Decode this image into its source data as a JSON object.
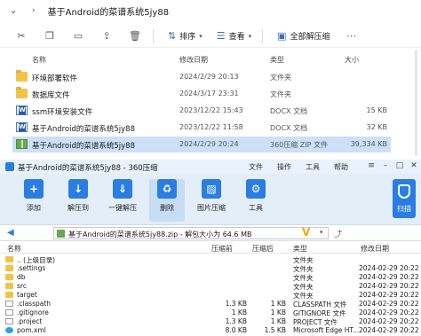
{
  "explorer": {
    "breadcrumb": "基于Android的菜谱系统5jy88",
    "toolbar": {
      "sort_label": "排序",
      "view_label": "查看",
      "extract_all_label": "全部解压缩"
    },
    "columns": {
      "name": "名称",
      "date": "修改日期",
      "type": "类型",
      "size": "大小"
    },
    "files": [
      {
        "name": "环境部署软件",
        "date": "2024/2/29 20:13",
        "type": "文件夹",
        "size": "",
        "icon": "folder-icon",
        "selected": false
      },
      {
        "name": "数据库文件",
        "date": "2024/3/17 23:31",
        "type": "文件夹",
        "size": "",
        "icon": "folder-icon",
        "selected": false
      },
      {
        "name": "ssm环境安装文件",
        "date": "2023/12/22 15:43",
        "type": "DOCX 文档",
        "size": "15 KB",
        "icon": "docx-icon",
        "selected": false
      },
      {
        "name": "基于Android的菜谱系统5jy88",
        "date": "2023/12/22 11:58",
        "type": "DOCX 文档",
        "size": "32 KB",
        "icon": "docx-icon",
        "selected": false
      },
      {
        "name": "基于Android的菜谱系统5jy88",
        "date": "2024/2/29 20:24",
        "type": "360压缩 ZIP 文件",
        "size": "39,334 KB",
        "icon": "zip-icon",
        "selected": true
      }
    ]
  },
  "zipwin": {
    "title": "基于Android的菜谱系统5jy88 - 360压缩",
    "menu": [
      "文件",
      "操作",
      "工具",
      "帮助"
    ],
    "toolbar": [
      {
        "label": "添加",
        "icon": "add-icon"
      },
      {
        "label": "解压到",
        "icon": "extract-to-icon"
      },
      {
        "label": "一键解压",
        "icon": "one-click-extract-icon"
      },
      {
        "label": "删除",
        "icon": "delete-icon",
        "active": true
      },
      {
        "label": "图片压缩",
        "icon": "image-compress-icon"
      },
      {
        "label": "工具",
        "icon": "tools-icon"
      }
    ],
    "scan_label": "扫描",
    "path": "基于Android的菜谱系统5jy88.zip - 解包大小为 64.6 MB",
    "columns": {
      "name": "名称",
      "compressed": "压缩前",
      "uncompressed": "压缩后",
      "type": "类型",
      "modified": "修改日期"
    },
    "rows": [
      {
        "name": ".. (上级目录)",
        "compressed": "",
        "uncompressed": "",
        "type": "文件夹",
        "modified": "",
        "icon": "folder"
      },
      {
        "name": ".settings",
        "compressed": "",
        "uncompressed": "",
        "type": "文件夹",
        "modified": "2024-02-29 20:22",
        "icon": "folder"
      },
      {
        "name": "db",
        "compressed": "",
        "uncompressed": "",
        "type": "文件夹",
        "modified": "2024-02-29 20:22",
        "icon": "folder"
      },
      {
        "name": "src",
        "compressed": "",
        "uncompressed": "",
        "type": "文件夹",
        "modified": "2024-02-29 20:22",
        "icon": "folder"
      },
      {
        "name": "target",
        "compressed": "",
        "uncompressed": "",
        "type": "文件夹",
        "modified": "2024-02-29 20:22",
        "icon": "folder"
      },
      {
        "name": ".classpath",
        "compressed": "1.3 KB",
        "uncompressed": "1 KB",
        "type": "CLASSPATH 文件",
        "modified": "2024-02-29 20:22",
        "icon": "file"
      },
      {
        "name": ".gitignore",
        "compressed": "1 KB",
        "uncompressed": "1 KB",
        "type": "GITIGNORE 文件",
        "modified": "2024-02-29 20:22",
        "icon": "file"
      },
      {
        "name": ".project",
        "compressed": "1.3 KB",
        "uncompressed": "1 KB",
        "type": "PROJECT 文件",
        "modified": "2024-02-29 20:22",
        "icon": "file"
      },
      {
        "name": "pom.xml",
        "compressed": "8.0 KB",
        "uncompressed": "1.5 KB",
        "type": "Microsoft Edge HT...",
        "modified": "2024-02-29 20:22",
        "icon": "edge"
      }
    ]
  }
}
